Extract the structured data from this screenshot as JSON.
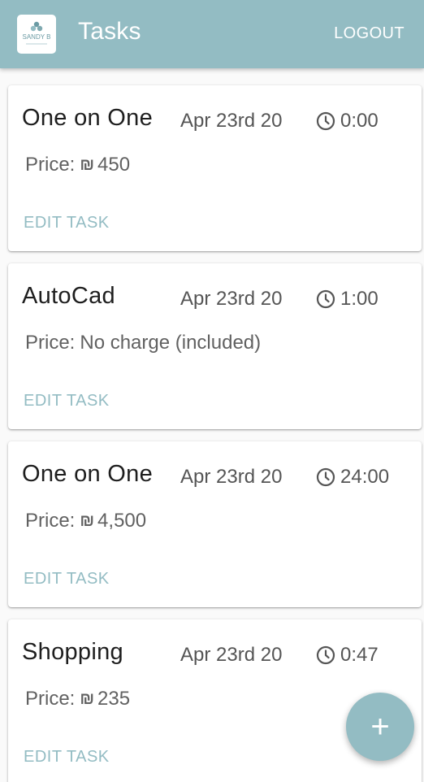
{
  "header": {
    "title": "Tasks",
    "logout_label": "LOGOUT",
    "logo_text": "SANDY B"
  },
  "tasks": [
    {
      "title": "One on One",
      "date": "Apr 23rd 20",
      "duration": "0:00",
      "price_label": "Price:",
      "price_symbol": "₪",
      "price_value": "450",
      "edit_label": "EDIT TASK"
    },
    {
      "title": "AutoCad",
      "date": "Apr 23rd 20",
      "duration": "1:00",
      "price_label": "Price:",
      "price_symbol": "",
      "price_value": "No charge (included)",
      "edit_label": "EDIT TASK"
    },
    {
      "title": "One on One",
      "date": "Apr 23rd 20",
      "duration": "24:00",
      "price_label": "Price:",
      "price_symbol": "₪",
      "price_value": "4,500",
      "edit_label": "EDIT TASK"
    },
    {
      "title": "Shopping",
      "date": "Apr 23rd 20",
      "duration": "0:47",
      "price_label": "Price:",
      "price_symbol": "₪",
      "price_value": "235",
      "edit_label": "EDIT TASK"
    }
  ],
  "fab": {
    "icon": "plus-icon",
    "label": "+"
  },
  "colors": {
    "primary": "#93bcc3",
    "text": "#1e1e1e",
    "muted": "#616161"
  }
}
